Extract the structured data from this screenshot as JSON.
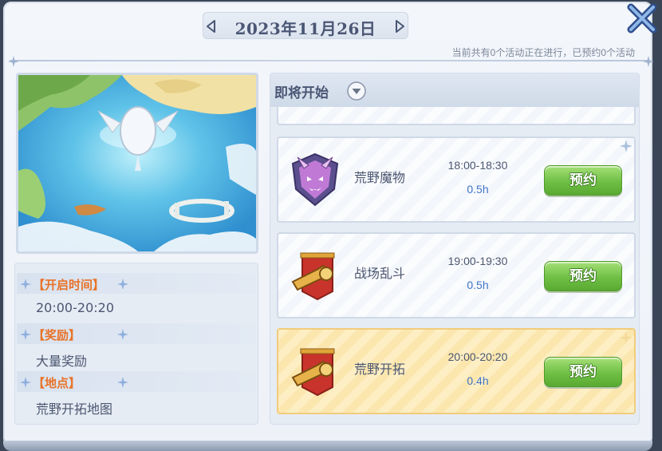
{
  "header": {
    "date": "2023年11月26日",
    "status_text": "当前共有0个活动正在进行，已预约0个活动"
  },
  "info": {
    "open_time_label": "【开启时间】",
    "open_time_value": "20:00-20:20",
    "reward_label": "【奖励】",
    "reward_value": "大量奖励",
    "location_label": "【地点】",
    "location_value": "荒野开拓地图"
  },
  "list": {
    "title": "即将开始",
    "items": [
      {
        "name": "荒野魔物",
        "time": "18:00-18:30",
        "duration": "0.5h",
        "button": "预约",
        "icon": "demon-mask-emblem-icon"
      },
      {
        "name": "战场乱斗",
        "time": "19:00-19:30",
        "duration": "0.5h",
        "button": "预约",
        "icon": "horn-banner-icon"
      },
      {
        "name": "荒野开拓",
        "time": "20:00-20:20",
        "duration": "0.4h",
        "button": "预约",
        "icon": "horn-banner-icon"
      }
    ]
  },
  "colors": {
    "accent_orange": "#e8732a",
    "duration_blue": "#3f74c9",
    "button_green": "#6fbf45",
    "highlight_card": "#fbe6ae"
  }
}
